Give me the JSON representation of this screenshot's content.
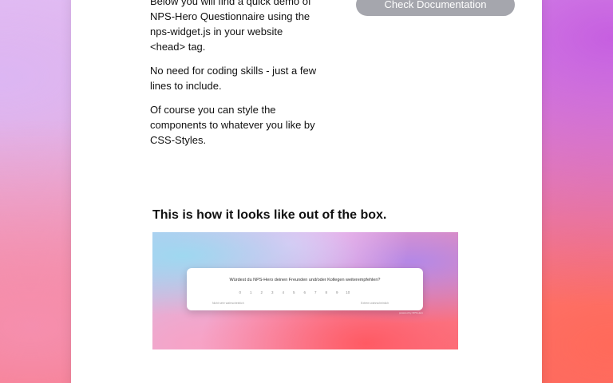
{
  "intro": {
    "paragraphs": [
      "Below you will find a quick demo of NPS-Hero Questionnaire using the nps-widget.js in your website <head> tag.",
      "No need for coding skills - just a few lines to include.",
      "Of course you can style the components to whatever you like by CSS-Styles."
    ]
  },
  "actions": {
    "docs_label": "Check Documentation"
  },
  "preview_section": {
    "heading": "This is how it looks like out of the box.",
    "widget": {
      "question": "Würdest du NPS-Hero deinen Freunden und/oder Kollegen weiterempfehlen?",
      "scores": [
        "0",
        "1",
        "2",
        "3",
        "4",
        "5",
        "6",
        "7",
        "8",
        "9",
        "10"
      ],
      "low_label": "Nicht sehr wahrscheinlich",
      "high_label": "Extrem wahrscheinlich",
      "powered_by": "powered by NPS-Hero"
    }
  },
  "colors": {
    "button_bg": "#a5a6ad",
    "card_bg": "#ffffff",
    "text": "#111111"
  }
}
